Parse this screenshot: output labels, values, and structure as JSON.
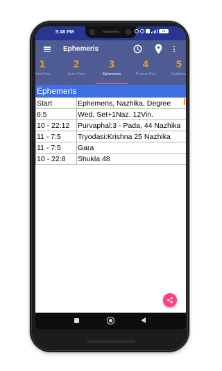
{
  "status_bar": {
    "time": "5:48 PM",
    "battery": "78"
  },
  "toolbar": {
    "title": "Ephemeris",
    "icons": [
      "menu-icon",
      "clock-icon",
      "location-pin-icon",
      "more-vert-icon"
    ]
  },
  "tabs": [
    {
      "number": "1",
      "label": "AstroDay"
    },
    {
      "number": "2",
      "label": "AstroTime"
    },
    {
      "number": "3",
      "label": "Ephemeris",
      "active": true
    },
    {
      "number": "4",
      "label": "Prasna Pos"
    },
    {
      "number": "5",
      "label": "Kalahora"
    }
  ],
  "section": {
    "title": "Ephemeris"
  },
  "table": {
    "rows": [
      [
        "Start",
        "Ephemeris, Nazhika, Degree"
      ],
      [
        "6:5",
        "Wed, Set+1Naz. 12Vin."
      ],
      [
        "10 - 22:12",
        "Purvaphal:3 - Pada, 44 Nazhika"
      ],
      [
        "11 - 7:5",
        "Tryodasi:Krishna 25 Nazhika"
      ],
      [
        "11 - 7:5",
        "Gara"
      ],
      [
        "10 - 22:8",
        "Shukla 48"
      ]
    ]
  },
  "fab": {
    "icon": "share-icon"
  },
  "colors": {
    "status_bar": "#283593",
    "toolbar": "#4f5b93",
    "section_header": "#3f6ee0",
    "accent": "#ff4081",
    "tab_number": "#e09a2e"
  }
}
